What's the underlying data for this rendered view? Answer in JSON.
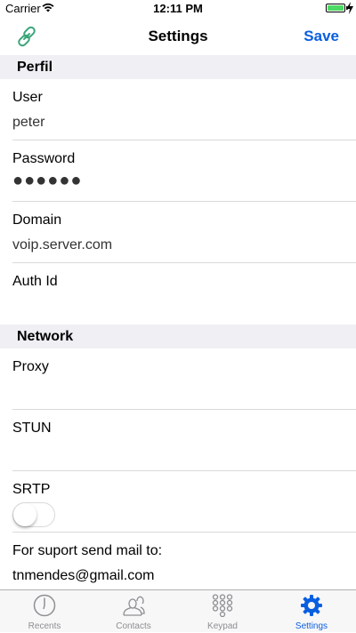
{
  "status_bar": {
    "carrier": "Carrier",
    "time": "12:11 PM",
    "battery_color": "#4cd964"
  },
  "nav": {
    "left_icon": "link-icon",
    "title": "Settings",
    "save_label": "Save",
    "accent_color": "#0a5fe0"
  },
  "sections": {
    "profile": {
      "header": "Perfil",
      "user": {
        "label": "User",
        "value": "peter"
      },
      "password": {
        "label": "Password",
        "value": "●●●●●●"
      },
      "domain": {
        "label": "Domain",
        "value": "voip.server.com"
      },
      "auth_id": {
        "label": "Auth Id",
        "value": ""
      }
    },
    "network": {
      "header": "Network",
      "proxy": {
        "label": "Proxy",
        "value": ""
      },
      "stun": {
        "label": "STUN",
        "value": ""
      },
      "srtp": {
        "label": "SRTP",
        "enabled": false
      }
    },
    "support": {
      "label": "For suport send mail to:",
      "email": "tnmendes@gmail.com"
    }
  },
  "tab_bar": {
    "tabs": [
      {
        "label": "Recents",
        "icon": "clock-icon",
        "active": false
      },
      {
        "label": "Contacts",
        "icon": "contacts-icon",
        "active": false
      },
      {
        "label": "Keypad",
        "icon": "keypad-icon",
        "active": false
      },
      {
        "label": "Settings",
        "icon": "gear-icon",
        "active": true
      }
    ]
  }
}
